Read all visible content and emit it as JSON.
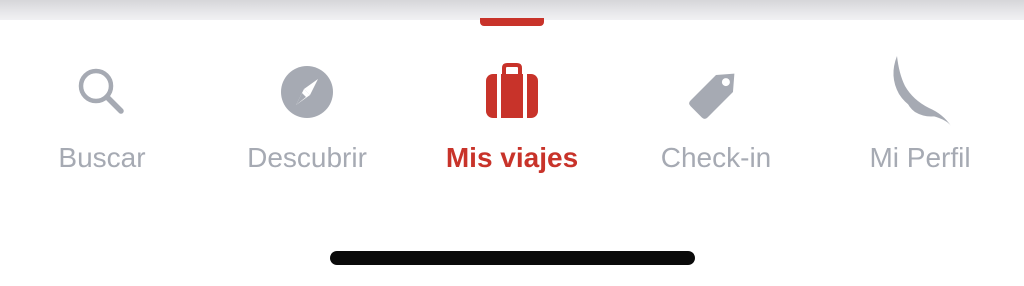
{
  "colors": {
    "active": "#c8332a",
    "inactive": "#a6aab3",
    "background": "#ffffff"
  },
  "tabbar": {
    "active_index": 2,
    "tabs": [
      {
        "label": "Buscar",
        "icon": "search-icon"
      },
      {
        "label": "Descubrir",
        "icon": "compass-icon"
      },
      {
        "label": "Mis viajes",
        "icon": "suitcase-icon"
      },
      {
        "label": "Check-in",
        "icon": "tag-icon"
      },
      {
        "label": "Mi Perfil",
        "icon": "bird-logo-icon"
      }
    ]
  }
}
